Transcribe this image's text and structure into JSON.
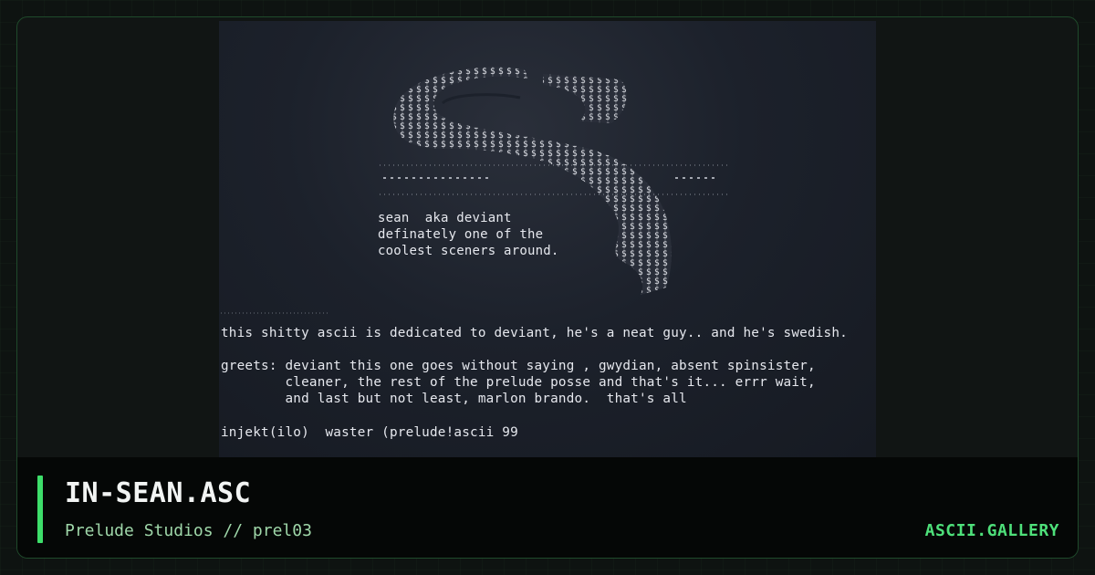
{
  "artwork": {
    "caption": "sean  aka deviant\ndefinately one of the\ncoolest sceners around.",
    "dedication": "this shitty ascii is dedicated to deviant, he's a neat guy.. and he's swedish.",
    "greets": "greets: deviant this one goes without saying , gwydian, absent spinsister,\n        cleaner, the rest of the prelude posse and that's it... errr wait,\n        and last but not least, marlon brando.  that's all",
    "signoff": "injekt(ilo)  waster (prelude!ascii 99"
  },
  "footer": {
    "title": "IN-SEAN.ASC",
    "subtitle": "Prelude Studios // prel03",
    "brand": "ASCII.GALLERY"
  },
  "colors": {
    "accent": "#3dde6a",
    "brand": "#4ee07a",
    "border": "#1f4a2b"
  }
}
